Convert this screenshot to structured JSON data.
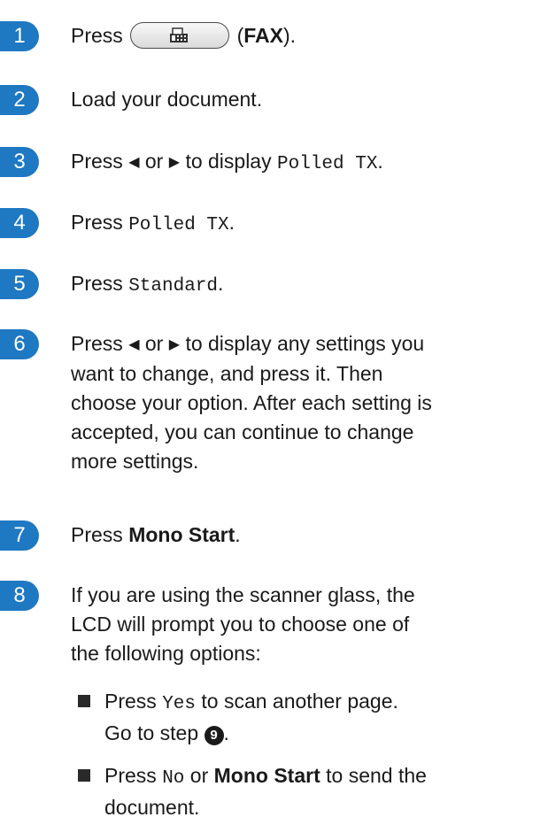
{
  "colors": {
    "step_badge": "#1e78c2"
  },
  "steps": [
    {
      "num": "1",
      "press": "Press",
      "fax_label": "FAX",
      "open": " (",
      "close": ")."
    },
    {
      "num": "2",
      "text": "Load your document."
    },
    {
      "num": "3",
      "press": "Press",
      "or": "or",
      "to_display": "to display",
      "code": "Polled TX",
      "end": "."
    },
    {
      "num": "4",
      "press": "Press",
      "code": "Polled TX",
      "end": "."
    },
    {
      "num": "5",
      "press": "Press",
      "code": "Standard",
      "end": "."
    },
    {
      "num": "6",
      "press": "Press",
      "or": "or",
      "rest_1": "to display any settings you",
      "lines": [
        "want to change, and press it. Then",
        "choose your option. After each setting is",
        "accepted, you can continue to change",
        "more settings."
      ]
    },
    {
      "num": "7",
      "press": "Press",
      "bold": "Mono Start",
      "end": "."
    },
    {
      "num": "8",
      "lines": [
        "If you are using the scanner glass, the",
        "LCD will prompt you to choose one of",
        "the following options:"
      ]
    }
  ],
  "bullets": [
    {
      "press": "Press",
      "code": "Yes",
      "after": "to scan another page.",
      "line2_pre": "Go to step",
      "ref": "9",
      "line2_end": "."
    },
    {
      "press": "Press",
      "code": "No",
      "or": "or",
      "bold": "Mono Start",
      "after": "to send the",
      "line2": "document."
    }
  ],
  "icons": {
    "fax_key": "fax-machine-icon",
    "left": "left-triangle-icon",
    "right": "right-triangle-icon",
    "bullet": "square-bullet-icon"
  }
}
